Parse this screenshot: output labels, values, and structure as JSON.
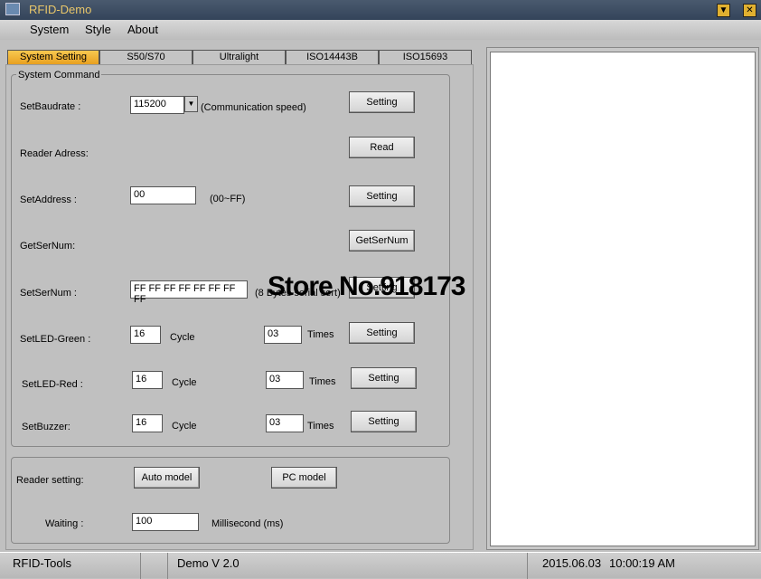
{
  "window": {
    "title": "RFID-Demo",
    "minimize": "▼",
    "close": "✕"
  },
  "menu": [
    "System",
    "Style",
    "About"
  ],
  "tabs": [
    "System Setting",
    "S50/S70",
    "Ultralight",
    "ISO14443B",
    "ISO15693"
  ],
  "system_command": {
    "legend": "System Command",
    "baudrate": {
      "label": "SetBaudrate :",
      "value": "115200",
      "hint": "(Communication speed)",
      "button": "Setting"
    },
    "reader_address": {
      "label": "Reader Adress:",
      "button": "Read"
    },
    "set_address": {
      "label": "SetAddress :",
      "value": "00",
      "hint": "(00~FF)",
      "button": "Setting"
    },
    "get_sernum": {
      "label": "GetSerNum:",
      "button": "GetSerNum"
    },
    "set_sernum": {
      "label": "SetSerNum :",
      "value": "FF FF FF FF FF FF FF FF",
      "hint": "(8 Bytes serial sert)",
      "button": "Setting"
    },
    "led_green": {
      "label": "SetLED-Green :",
      "cycle": "16",
      "cycle_label": "Cycle",
      "times": "03",
      "times_label": "Times",
      "button": "Setting"
    },
    "led_red": {
      "label": "SetLED-Red :",
      "cycle": "16",
      "cycle_label": "Cycle",
      "times": "03",
      "times_label": "Times",
      "button": "Setting"
    },
    "buzzer": {
      "label": "SetBuzzer:",
      "cycle": "16",
      "cycle_label": "Cycle",
      "times": "03",
      "times_label": "Times",
      "button": "Setting"
    }
  },
  "reader_setting": {
    "label": "Reader setting:",
    "auto": "Auto model",
    "pc": "PC model",
    "waiting_label": "Waiting :",
    "waiting": "100",
    "unit": "Millisecond (ms)"
  },
  "status": {
    "app": "RFID-Tools",
    "version": "Demo  V 2.0",
    "date": "2015.06.03",
    "time": "10:00:19 AM"
  },
  "watermark": "Store No.918173"
}
